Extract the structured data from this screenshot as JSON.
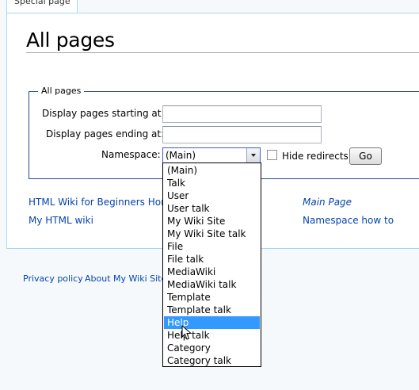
{
  "tab": {
    "label": "Special page"
  },
  "page": {
    "title": "All pages"
  },
  "form": {
    "legend": "All pages",
    "start_label": "Display pages starting at:",
    "start_value": "",
    "end_label": "Display pages ending at:",
    "end_value": "",
    "namespace_label": "Namespace:",
    "namespace_value": "(Main)",
    "hide_redirects_label": "Hide redirects",
    "hide_redirects_checked": false,
    "go_label": "Go"
  },
  "pages": [
    {
      "label": "HTML Wiki for Beginners Hor",
      "italic": false
    },
    {
      "label": "My HTML wiki",
      "italic": false
    },
    {
      "label": "Main Page",
      "italic": true
    },
    {
      "label": "Namespace how to",
      "italic": false
    }
  ],
  "footer": {
    "privacy": "Privacy policy",
    "about": "About My Wiki Site"
  },
  "dropdown": {
    "selected_index": 12,
    "options": [
      "(Main)",
      "Talk",
      "User",
      "User talk",
      "My Wiki Site",
      "My Wiki Site talk",
      "File",
      "File talk",
      "MediaWiki",
      "MediaWiki talk",
      "Template",
      "Template talk",
      "Help",
      "Help talk",
      "Category",
      "Category talk"
    ]
  },
  "colors": {
    "link": "#0645ad",
    "highlight": "#3399ff",
    "border": "#a7d7f9"
  }
}
